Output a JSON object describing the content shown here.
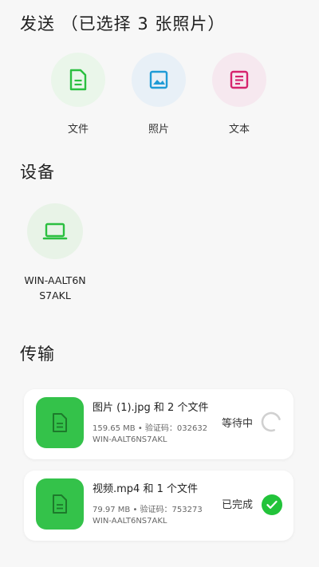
{
  "send": {
    "title": "发送 （已选择 3 张照片）",
    "options": [
      {
        "label": "文件",
        "icon": "file-icon",
        "color": "#2bbf40",
        "bg": "#eaf6ea"
      },
      {
        "label": "照片",
        "icon": "image-icon",
        "color": "#1f9bd6",
        "bg": "#e8f0f7"
      },
      {
        "label": "文本",
        "icon": "note-icon",
        "color": "#d6246e",
        "bg": "#f6e8ef"
      }
    ]
  },
  "devices": {
    "title": "设备",
    "items": [
      {
        "name": "WIN-AALT6NS7AKL",
        "icon": "laptop-icon",
        "color": "#2bbf40"
      }
    ]
  },
  "transfers": {
    "title": "传输",
    "items": [
      {
        "title": "图片 (1).jpg 和 2 个文件",
        "meta": "159.65 MB • 验证码：032632",
        "device": "WIN-AALT6NS7AKL",
        "status": "等待中",
        "state": "waiting"
      },
      {
        "title": "视频.mp4 和 1 个文件",
        "meta": "79.97 MB • 验证码：753273",
        "device": "WIN-AALT6NS7AKL",
        "status": "已完成",
        "state": "done"
      }
    ]
  }
}
